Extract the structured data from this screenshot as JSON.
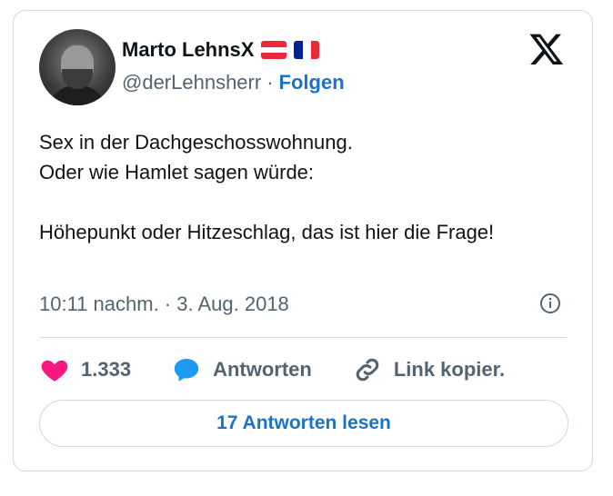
{
  "author": {
    "name": "Marto LehnsX",
    "handle": "@derLehnsherr",
    "separator": "·",
    "follow_label": "Folgen"
  },
  "tweet": {
    "text": "Sex in der Dachgeschosswohnung.\nOder wie Hamlet sagen würde:\n\nHöhepunkt oder Hitzeschlag, das ist hier die Frage!",
    "timestamp": "10:11 nachm. · 3. Aug. 2018"
  },
  "actions": {
    "likes": "1.333",
    "reply_label": "Antworten",
    "copy_link_label": "Link kopier."
  },
  "read_replies_label": "17 Antworten lesen",
  "icons": {
    "logo": "x-logo-icon",
    "info": "info-icon",
    "like": "heart-icon",
    "reply": "speech-bubble-icon",
    "link": "link-icon"
  },
  "colors": {
    "accent": "#1a73c8",
    "heart": "#f91880",
    "reply_bubble": "#1d9bf0",
    "muted": "#536471"
  }
}
